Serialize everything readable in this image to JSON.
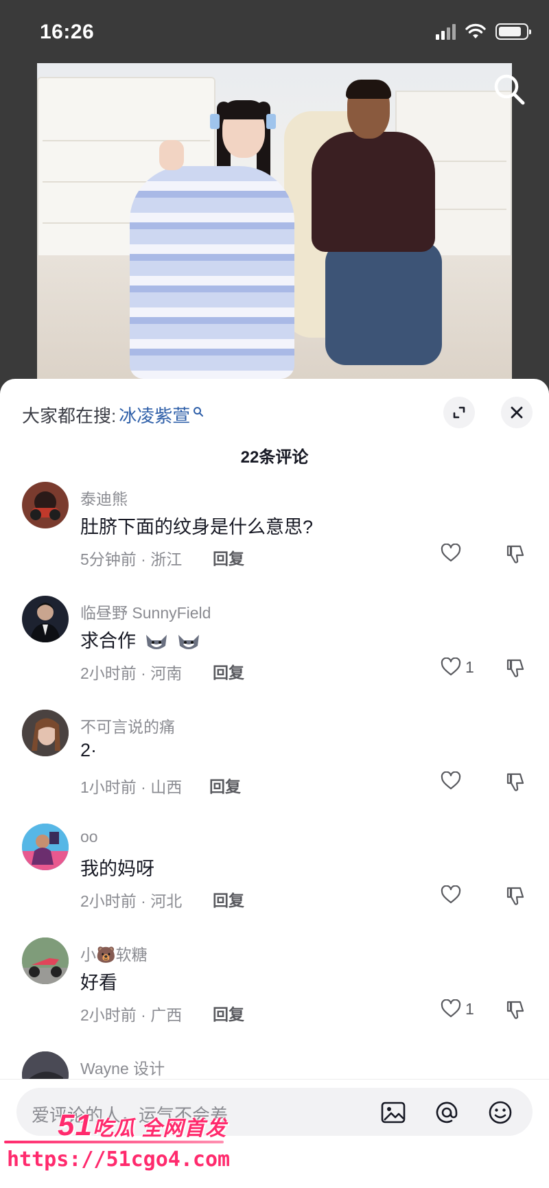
{
  "status_bar": {
    "time": "16:26"
  },
  "sheet": {
    "trending_label": "大家都在搜:",
    "trending_term": "冰凌紫萱",
    "comment_count": "22条评论"
  },
  "comments": [
    {
      "user": "泰迪熊",
      "text": "肚脐下面的纹身是什么意思?",
      "time": "5分钟前 · 浙江",
      "reply": "回复",
      "likes": "",
      "avatar_color": "#7a3b2e"
    },
    {
      "user": "临昼野 SunnyField",
      "text": "求合作",
      "time": "2小时前 · 河南",
      "reply": "回复",
      "likes": "1",
      "avatar_color": "#1d2230"
    },
    {
      "user": "不可言说的痛",
      "text": "2·",
      "time": "1小时前 · 山西",
      "reply": "回复",
      "likes": "",
      "avatar_color": "#5b4a48"
    },
    {
      "user": "oo",
      "text": "我的妈呀",
      "time": "2小时前 · 河北",
      "reply": "回复",
      "likes": "",
      "avatar_color": "#3fa0d8"
    },
    {
      "user": "小🐻软糖",
      "text": "好看",
      "time": "2小时前 · 广西",
      "reply": "回复",
      "likes": "1",
      "avatar_color": "#6d8a6a"
    },
    {
      "user": "Wayne 设计",
      "text": "",
      "time": "",
      "reply": "",
      "likes": "",
      "avatar_color": "#3b3b44"
    }
  ],
  "input": {
    "placeholder": "爱评论的人，运气不会差"
  },
  "watermark": {
    "brand_num": "51",
    "brand_text": "吃瓜 全网首发",
    "url": "https://51cgo4.com"
  },
  "icons": {
    "search": "search-icon",
    "expand": "expand-icon",
    "close": "close-icon",
    "like": "heart-icon",
    "dislike": "thumbs-down-icon",
    "image": "image-icon",
    "at": "at-icon",
    "emoji": "emoji-icon"
  }
}
